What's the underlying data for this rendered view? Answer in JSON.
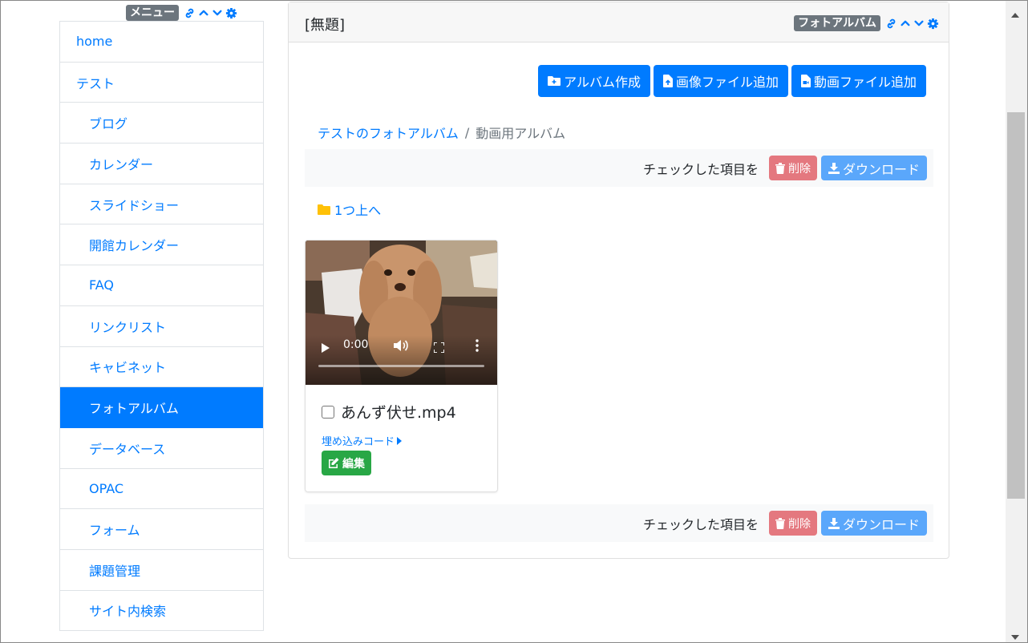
{
  "menu_frame": {
    "badge": "メニュー",
    "icons": [
      "link-icon",
      "chevron-up-icon",
      "chevron-down-icon",
      "gear-icon"
    ]
  },
  "menu": {
    "items": [
      {
        "label": "home",
        "level": 0,
        "active": false
      },
      {
        "label": "テスト",
        "level": 0,
        "active": false
      },
      {
        "label": "ブログ",
        "level": 1,
        "active": false
      },
      {
        "label": "カレンダー",
        "level": 1,
        "active": false
      },
      {
        "label": "スライドショー",
        "level": 1,
        "active": false
      },
      {
        "label": "開館カレンダー",
        "level": 1,
        "active": false
      },
      {
        "label": "FAQ",
        "level": 1,
        "active": false
      },
      {
        "label": "リンクリスト",
        "level": 1,
        "active": false
      },
      {
        "label": "キャビネット",
        "level": 1,
        "active": false
      },
      {
        "label": "フォトアルバム",
        "level": 1,
        "active": true
      },
      {
        "label": "データベース",
        "level": 1,
        "active": false
      },
      {
        "label": "OPAC",
        "level": 1,
        "active": false
      },
      {
        "label": "フォーム",
        "level": 1,
        "active": false
      },
      {
        "label": "課題管理",
        "level": 1,
        "active": false
      },
      {
        "label": "サイト内検索",
        "level": 1,
        "active": false
      }
    ]
  },
  "card": {
    "title": "[無題]",
    "frame_badge": "フォトアルバム",
    "actions": {
      "create_album": "アルバム作成",
      "add_image": "画像ファイル追加",
      "add_video": "動画ファイル追加"
    },
    "breadcrumb": {
      "parent": "テストのフォトアルバム",
      "separator": "/",
      "current": "動画用アルバム"
    },
    "bulk": {
      "label": "チェックした項目を",
      "delete": "削除",
      "download": "ダウンロード"
    },
    "up_link": "1つ上へ",
    "item": {
      "video_time": "0:00",
      "file_name": "あんず伏せ.mp4",
      "embed_link": "埋め込みコード",
      "edit": "編集"
    }
  },
  "colors": {
    "primary": "#007bff",
    "active_menu": "#007bff",
    "danger_light": "#e4787f",
    "primary_light": "#5aa7fb",
    "success": "#28a745",
    "badge": "#6c757d",
    "folder": "#ffc107"
  }
}
